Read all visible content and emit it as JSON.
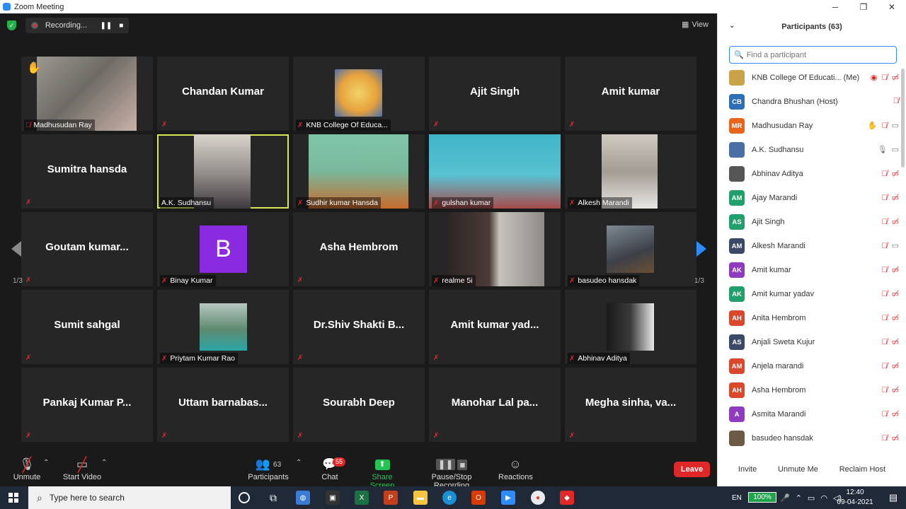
{
  "window": {
    "title": "Zoom Meeting",
    "controls": [
      "─",
      "❐",
      "✕"
    ]
  },
  "topbar": {
    "recording_label": "Recording...",
    "view_label": "View"
  },
  "tiles": [
    {
      "name": "Madhusudan Ray",
      "type": "video"
    },
    {
      "name": "Chandan Kumar",
      "type": "name"
    },
    {
      "name": "KNB College Of Educa...",
      "type": "logo"
    },
    {
      "name": "Ajit Singh",
      "type": "name"
    },
    {
      "name": "Amit kumar",
      "type": "name"
    },
    {
      "name": "Sumitra hansda",
      "type": "name"
    },
    {
      "name": "A.K. Sudhansu",
      "type": "video"
    },
    {
      "name": "Sudhir kumar Hansda",
      "type": "video"
    },
    {
      "name": "gulshan kumar",
      "type": "video"
    },
    {
      "name": "Alkesh Marandi",
      "type": "video"
    },
    {
      "name": "Goutam  kumar...",
      "type": "name"
    },
    {
      "name": "Binay Kumar",
      "type": "avatar",
      "initial": "B"
    },
    {
      "name": "Asha Hembrom",
      "type": "name"
    },
    {
      "name": "realme 5i",
      "type": "video"
    },
    {
      "name": "basudeo hansdak",
      "type": "photo"
    },
    {
      "name": "Sumit sahgal",
      "type": "name"
    },
    {
      "name": "Priytam Kumar Rao",
      "type": "photo"
    },
    {
      "name": "Dr.Shiv  Shakti  B...",
      "type": "name"
    },
    {
      "name": "Amit  kumar  yad...",
      "type": "name"
    },
    {
      "name": "Abhinav Aditya",
      "type": "photo"
    },
    {
      "name": "Pankaj Kumar P...",
      "type": "name"
    },
    {
      "name": "Uttam  barnabas...",
      "type": "name"
    },
    {
      "name": "Sourabh Deep",
      "type": "name"
    },
    {
      "name": "Manohar Lal pa...",
      "type": "name"
    },
    {
      "name": "Megha  sinha,  va...",
      "type": "name"
    }
  ],
  "pagination": {
    "left": "1/3",
    "right": "1/3"
  },
  "toolbar": {
    "unmute": "Unmute",
    "start_video": "Start Video",
    "participants": "Participants",
    "participants_count": "63",
    "chat": "Chat",
    "chat_badge": "55",
    "share_screen": "Share Screen",
    "pause_stop_recording": "Pause/Stop Recording",
    "reactions": "Reactions",
    "leave": "Leave"
  },
  "panel": {
    "title": "Participants (63)",
    "search_placeholder": "Find a participant",
    "participants": [
      {
        "name": "KNB College Of Educati...  (Me)",
        "initials": "",
        "color": "#c9a24a",
        "icons": [
          "rec",
          "mic-off",
          "vid-off"
        ]
      },
      {
        "name": "Chandra Bhushan (Host)",
        "initials": "CB",
        "color": "#2d6fb6",
        "icons": [
          "mic-off"
        ]
      },
      {
        "name": "Madhusudan Ray",
        "initials": "MR",
        "color": "#e8641b",
        "icons": [
          "hand",
          "mic-off",
          "vid-on"
        ]
      },
      {
        "name": "A.K. Sudhansu",
        "initials": "",
        "color": "#4a6fa5",
        "icons": [
          "mic-on",
          "vid-on"
        ]
      },
      {
        "name": "Abhinav Aditya",
        "initials": "",
        "color": "#555555",
        "icons": [
          "mic-off",
          "vid-off"
        ]
      },
      {
        "name": "Ajay Marandi",
        "initials": "AM",
        "color": "#22a06b",
        "icons": [
          "mic-off",
          "vid-off"
        ]
      },
      {
        "name": "Ajit Singh",
        "initials": "AS",
        "color": "#22a06b",
        "icons": [
          "mic-off",
          "vid-off"
        ]
      },
      {
        "name": "Alkesh Marandi",
        "initials": "AM",
        "color": "#3a4a66",
        "icons": [
          "mic-off",
          "vid-on"
        ]
      },
      {
        "name": "Amit kumar",
        "initials": "AK",
        "color": "#8e3bbf",
        "icons": [
          "mic-off",
          "vid-off"
        ]
      },
      {
        "name": "Amit kumar yadav",
        "initials": "AK",
        "color": "#22a06b",
        "icons": [
          "mic-off",
          "vid-off"
        ]
      },
      {
        "name": "Anita Hembrom",
        "initials": "AH",
        "color": "#d9482b",
        "icons": [
          "mic-off",
          "vid-off"
        ]
      },
      {
        "name": "Anjali Sweta Kujur",
        "initials": "AS",
        "color": "#3a4a66",
        "icons": [
          "mic-off",
          "vid-off"
        ]
      },
      {
        "name": "Anjela marandi",
        "initials": "AM",
        "color": "#d9482b",
        "icons": [
          "mic-off",
          "vid-off"
        ]
      },
      {
        "name": "Asha Hembrom",
        "initials": "AH",
        "color": "#d9482b",
        "icons": [
          "mic-off",
          "vid-off"
        ]
      },
      {
        "name": "Asmita Marandi",
        "initials": "A",
        "color": "#8e3bbf",
        "icons": [
          "mic-off",
          "vid-off"
        ]
      },
      {
        "name": "basudeo hansdak",
        "initials": "",
        "color": "#6d5a44",
        "icons": [
          "mic-off",
          "vid-off"
        ]
      }
    ],
    "footer": {
      "invite": "Invite",
      "unmute_me": "Unmute Me",
      "reclaim_host": "Reclaim Host"
    }
  },
  "taskbar": {
    "search_placeholder": "Type here to search",
    "lang": "EN",
    "battery": "100%",
    "time": "12:40",
    "date": "09-04-2021"
  }
}
